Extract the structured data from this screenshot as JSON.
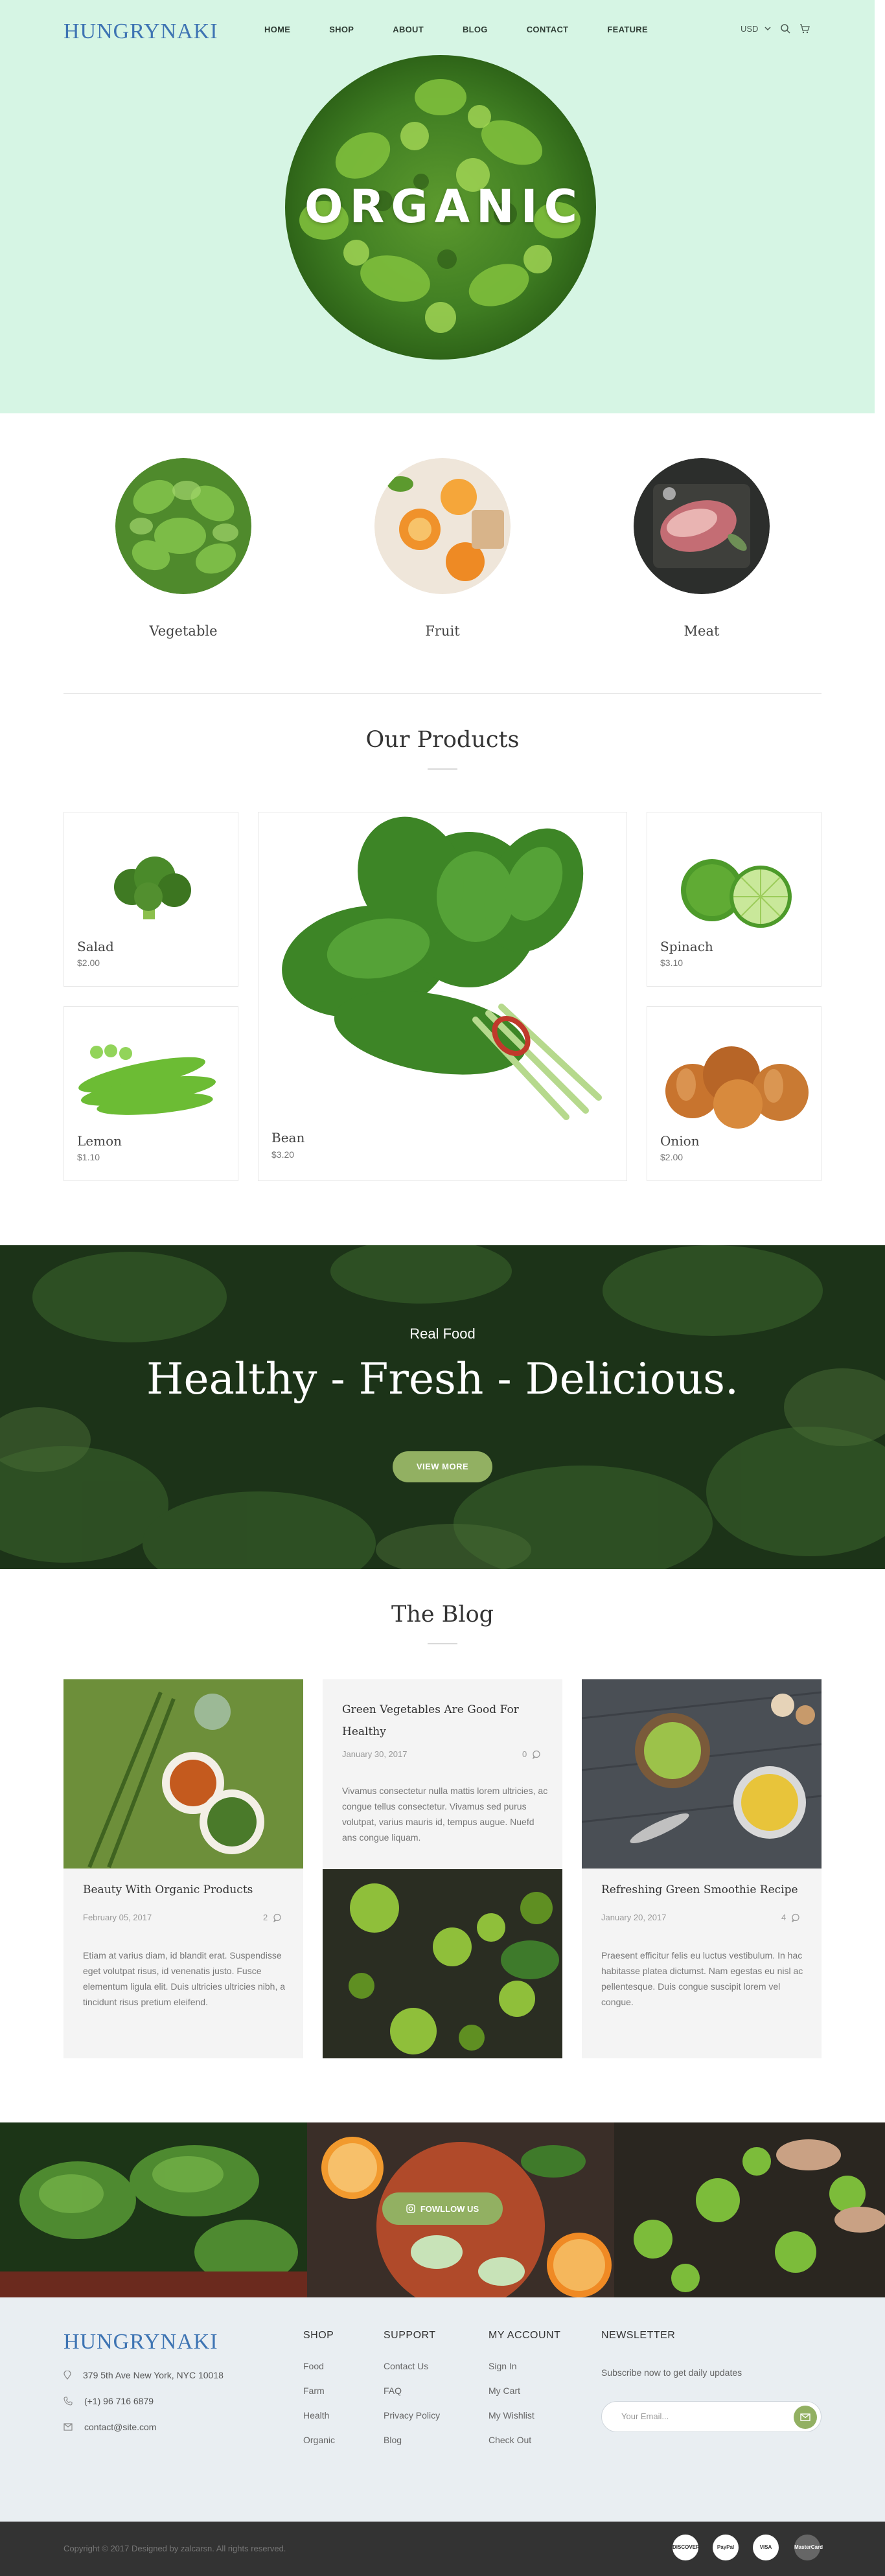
{
  "brand": {
    "logo": "HUNGRYNAKI"
  },
  "nav": {
    "items": [
      {
        "label": "HOME"
      },
      {
        "label": "SHOP"
      },
      {
        "label": "ABOUT"
      },
      {
        "label": "BLOG"
      },
      {
        "label": "CONTACT"
      },
      {
        "label": "FEATURE"
      }
    ],
    "currency": "USD"
  },
  "hero": {
    "word": "ORGANIC"
  },
  "categories": [
    {
      "label": "Vegetable"
    },
    {
      "label": "Fruit"
    },
    {
      "label": "Meat"
    }
  ],
  "products": {
    "title": "Our Products",
    "items": [
      {
        "name": "Salad",
        "price": "$2.00"
      },
      {
        "name": "Spinach",
        "price": "$3.10"
      },
      {
        "name": "Lemon",
        "price": "$1.10"
      },
      {
        "name": "Bean",
        "price": "$3.20"
      },
      {
        "name": "Onion",
        "price": "$2.00"
      }
    ]
  },
  "banner": {
    "kicker": "Real Food",
    "headline": "Healthy - Fresh - Delicious.",
    "button": "VIEW MORE"
  },
  "blog": {
    "title": "The Blog",
    "posts": [
      {
        "title": "Beauty With Organic Products",
        "date": "February 05, 2017",
        "comments": "2",
        "excerpt": "Etiam at varius diam, id blandit erat. Suspendisse eget volutpat risus, id venenatis justo. Fusce elementum ligula elit. Duis ultricies ultricies nibh, a tincidunt risus pretium eleifend."
      },
      {
        "title": "Green Vegetables Are Good For Healthy",
        "date": "January 30, 2017",
        "comments": "0",
        "excerpt": "Vivamus consectetur nulla mattis lorem ultricies, ac congue tellus consectetur. Vivamus sed purus volutpat, varius mauris id, tempus augue. Nuefd ans congue liquam."
      },
      {
        "title": "Refreshing Green Smoothie Recipe",
        "date": "January 20, 2017",
        "comments": "4",
        "excerpt": "Praesent efficitur felis eu luctus vestibulum. In hac habitasse platea dictumst. Nam egestas eu nisl ac pellentesque. Duis congue suscipit lorem vel congue."
      }
    ]
  },
  "instagram": {
    "button": "FOWLLOW US"
  },
  "footer": {
    "logo": "HUNGRYNAKI",
    "address": "379 5th Ave New York, NYC 10018",
    "phone": "(+1) 96 716 6879",
    "email": "contact@site.com",
    "columns": [
      {
        "title": "SHOP",
        "links": [
          "Food",
          "Farm",
          "Health",
          "Organic"
        ]
      },
      {
        "title": "SUPPORT",
        "links": [
          "Contact Us",
          "FAQ",
          "Privacy Policy",
          "Blog"
        ]
      },
      {
        "title": "MY ACCOUNT",
        "links": [
          "Sign In",
          "My Cart",
          "My Wishlist",
          "Check Out"
        ]
      }
    ],
    "newsletter": {
      "title": "NEWSLETTER",
      "text": "Subscribe now to get daily updates",
      "placeholder": "Your Email..."
    },
    "copyright": "Copyright © 2017 Designed by zalcarsn. All rights reserved.",
    "payments": [
      "DISCOVER",
      "PayPal",
      "VISA",
      "MasterCard"
    ]
  }
}
